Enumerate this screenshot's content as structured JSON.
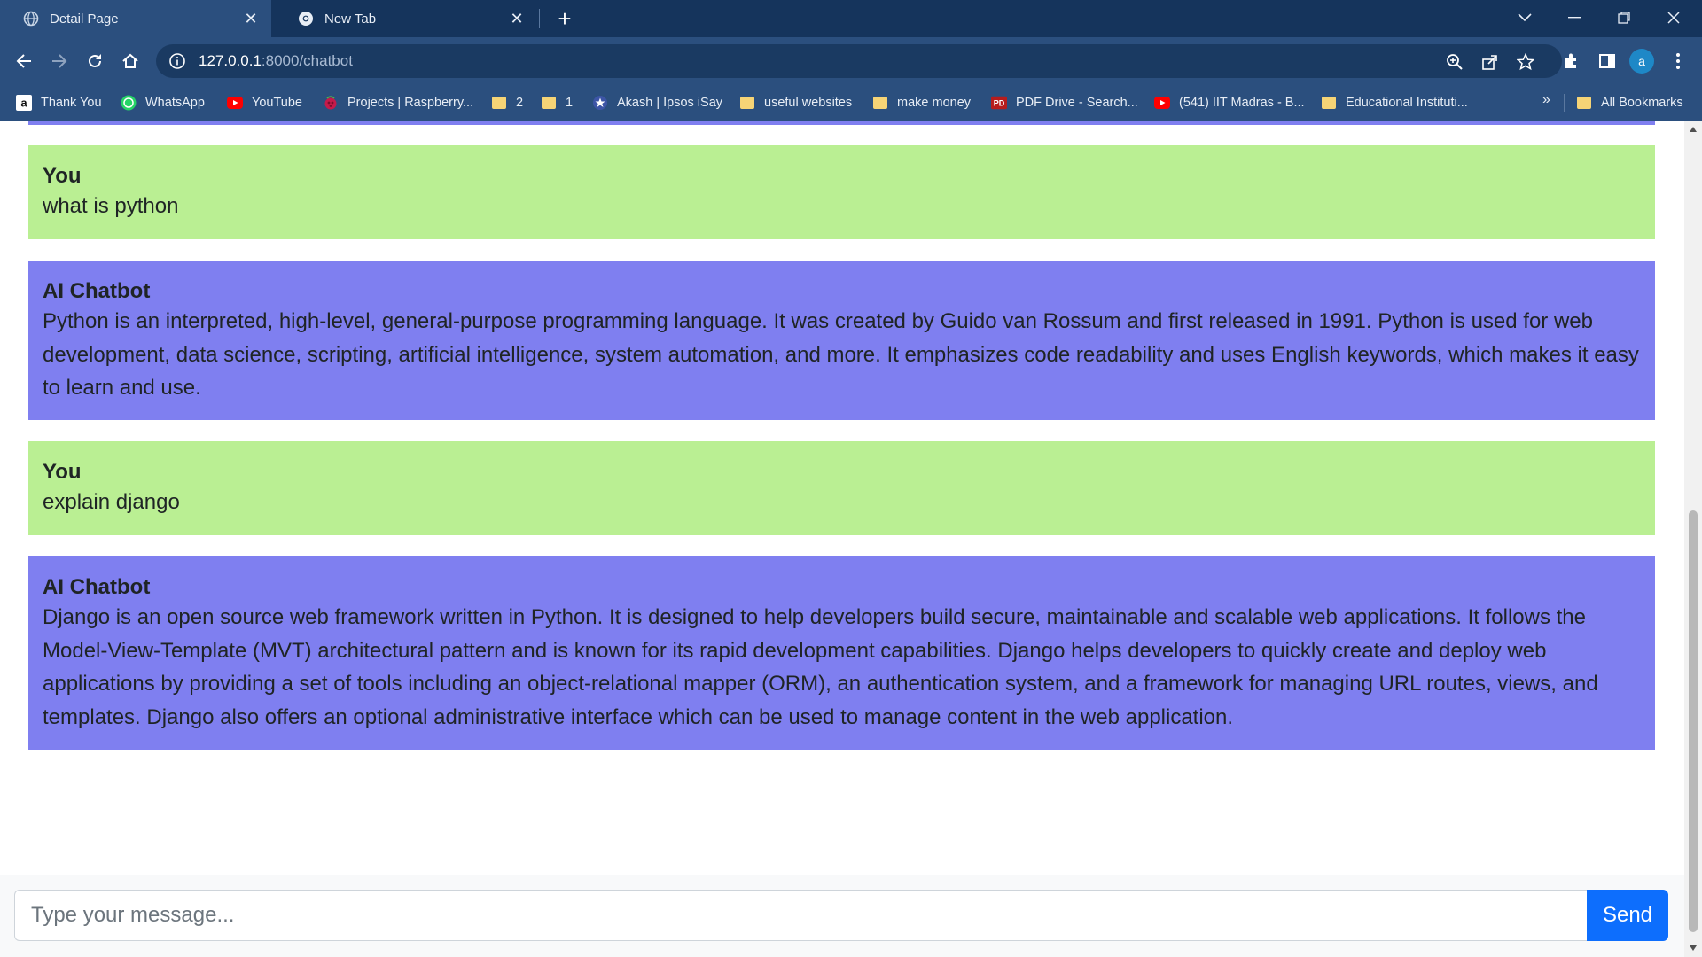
{
  "browser": {
    "tabs": [
      {
        "title": "Detail Page",
        "icon": "globe-icon",
        "active": true
      },
      {
        "title": "New Tab",
        "icon": "chrome-icon",
        "active": false
      }
    ],
    "new_tab_label": "+",
    "url": {
      "host": "127.0.0.1",
      "rest": ":8000/chatbot"
    },
    "profile_initial": "a",
    "bookmarks": [
      {
        "label": "Thank You",
        "icon": "amazon-icon"
      },
      {
        "label": "WhatsApp",
        "icon": "whatsapp-icon"
      },
      {
        "label": "YouTube",
        "icon": "youtube-icon"
      },
      {
        "label": "Projects | Raspberry...",
        "icon": "raspberry-icon"
      },
      {
        "label": "2",
        "icon": "folder-icon"
      },
      {
        "label": "1",
        "icon": "folder-icon"
      },
      {
        "label": "Akash | Ipsos iSay",
        "icon": "ipsos-icon"
      },
      {
        "label": "useful websites",
        "icon": "folder-icon"
      },
      {
        "label": "make money",
        "icon": "folder-icon"
      },
      {
        "label": "PDF Drive - Search...",
        "icon": "pdf-drive-icon"
      },
      {
        "label": "(541) IIT Madras - B...",
        "icon": "youtube-icon"
      },
      {
        "label": "Educational Instituti...",
        "icon": "folder-icon"
      }
    ],
    "overflow_label": "»",
    "all_bookmarks_label": "All Bookmarks",
    "colors": {
      "frame": "#15345c",
      "toolbar": "#2b4f7e"
    }
  },
  "chat": {
    "messages": [
      {
        "sender": "You",
        "text": "what is python",
        "role": "user"
      },
      {
        "sender": "AI Chatbot",
        "text": "Python is an interpreted, high-level, general-purpose programming language. It was created by Guido van Rossum and first released in 1991. Python is used for web development, data science, scripting, artificial intelligence, system automation, and more. It emphasizes code readability and uses English keywords, which makes it easy to learn and use.",
        "role": "bot"
      },
      {
        "sender": "You",
        "text": "explain django",
        "role": "user"
      },
      {
        "sender": "AI Chatbot",
        "text": "Django is an open source web framework written in Python. It is designed to help developers build secure, maintainable and scalable web applications. It follows the Model-View-Template (MVT) architectural pattern and is known for its rapid development capabilities. Django helps developers to quickly create and deploy web applications by providing a set of tools including an object-relational mapper (ORM), an authentication system, and a framework for managing URL routes, views, and templates. Django also offers an optional administrative interface which can be used to manage content in the web application.",
        "role": "bot"
      }
    ],
    "colors": {
      "user_bubble": "#baef93",
      "bot_bubble": "#7f7ff0",
      "send_button": "#0d6efd"
    },
    "composer": {
      "placeholder": "Type your message...",
      "value": "",
      "send_label": "Send"
    }
  }
}
